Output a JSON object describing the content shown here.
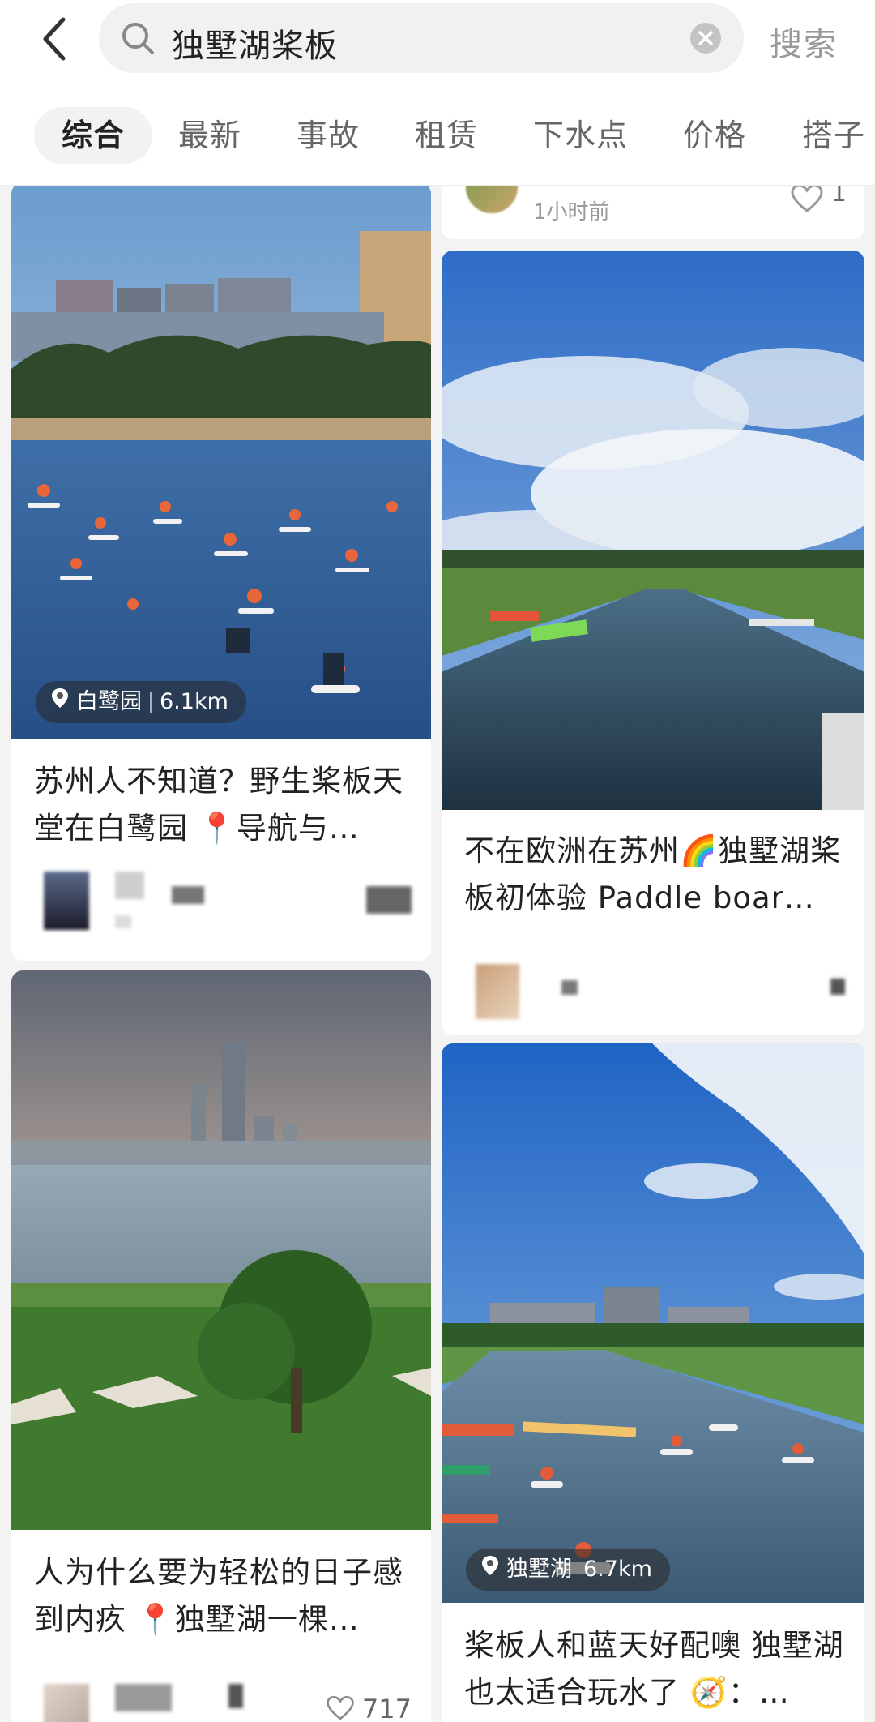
{
  "header": {
    "search_query": "独墅湖桨板",
    "search_button": "搜索"
  },
  "tabs": [
    "综合",
    "最新",
    "事故",
    "租赁",
    "下水点",
    "价格",
    "搭子"
  ],
  "feed": {
    "top_right_card": {
      "time": "1小时前",
      "likes": "1"
    },
    "cards": [
      {
        "title": "苏州人不知道？野生桨板天堂在白鹭园 📍导航与…",
        "location": "白鹭园",
        "distance": "6.1km"
      },
      {
        "title": "不在欧洲在苏州🌈独墅湖桨板初体验 Paddle boar…"
      },
      {
        "title": "人为什么要为轻松的日子感到内疚 📍独墅湖一棵…",
        "likes": "717"
      },
      {
        "title": "桨板人和蓝天好配噢 独墅湖也太适合玩水了 🧭：…",
        "location": "独墅湖",
        "distance": "6.7km"
      }
    ]
  },
  "colors": {
    "accent": "#222222",
    "muted": "#999999",
    "background": "#f3f3f3"
  }
}
